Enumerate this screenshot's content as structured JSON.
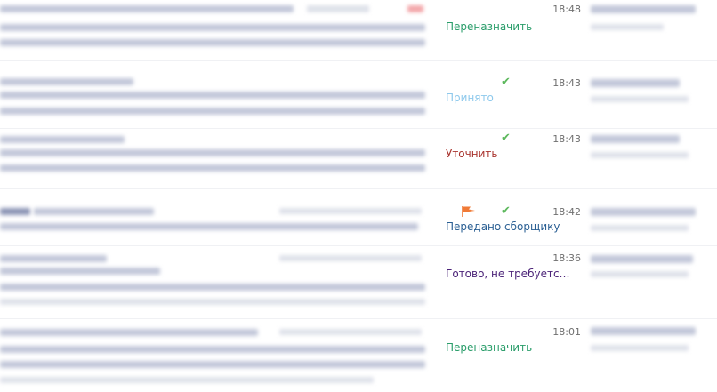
{
  "rows": [
    {
      "status": "Переназначить",
      "status_color": "#2a9d6a",
      "time": "18:48",
      "checked": false,
      "flagged": false
    },
    {
      "status": "Принято",
      "status_color": "#8ec9ec",
      "time": "18:43",
      "checked": true,
      "flagged": false
    },
    {
      "status": "Уточнить",
      "status_color": "#a9342e",
      "time": "18:43",
      "checked": true,
      "flagged": false
    },
    {
      "status": "Передано сборщику",
      "status_color": "#2a5f93",
      "time": "18:42",
      "checked": true,
      "flagged": true
    },
    {
      "status": "Готово, не требуется п...",
      "status_color": "#4b2378",
      "time": "18:36",
      "checked": false,
      "flagged": false
    },
    {
      "status": "Переназначить",
      "status_color": "#2a9d6a",
      "time": "18:01",
      "checked": false,
      "flagged": false
    }
  ],
  "icons": {
    "check": "check-icon",
    "flag": "flag-icon"
  },
  "colors": {
    "check": "#5cb85c",
    "flag": "#f07a36"
  }
}
